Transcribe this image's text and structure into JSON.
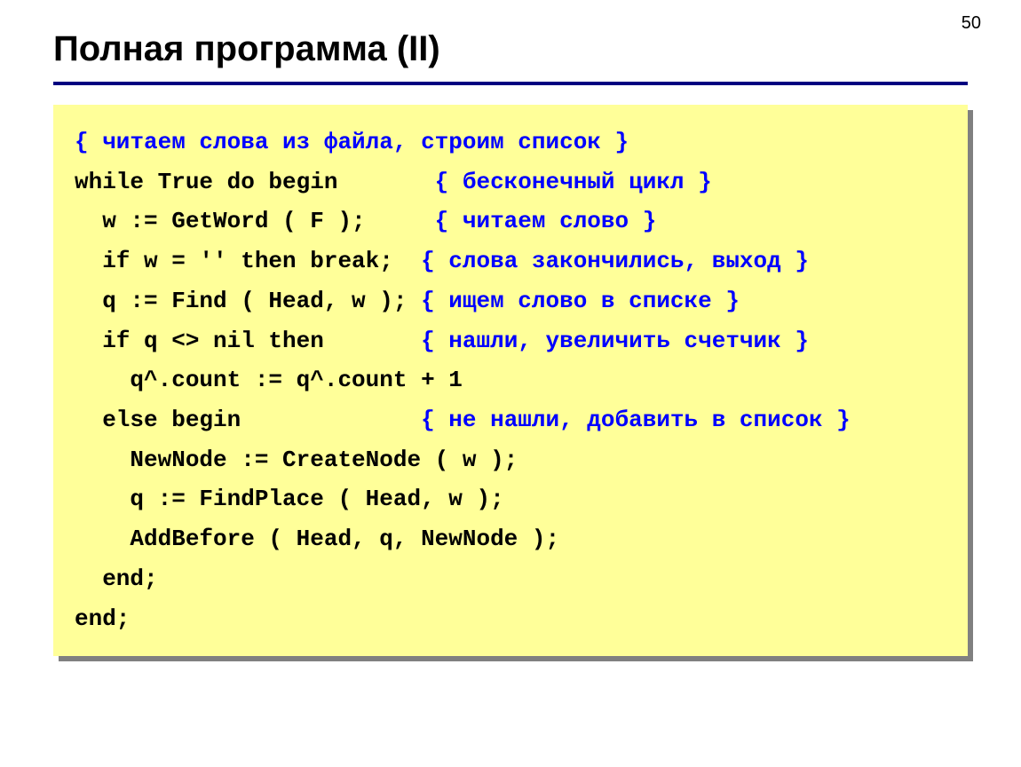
{
  "page_number": "50",
  "title": "Полная программа (II)",
  "code": {
    "line1_cmt": "{ читаем слова из файла, строим список }",
    "line2_kw": "while True do begin",
    "line2_cmt": "{ бесконечный цикл }",
    "line3_kw": "  w := GetWord ( F );",
    "line3_cmt": "{ читаем слово }",
    "line4_kw": "  if w = '' then break;",
    "line4_cmt": "{ слова закончились, выход }",
    "line5_kw": "  q := Find ( Head, w );",
    "line5_cmt": "{ ищем слово в списке }",
    "line6_kw": "  if q <> nil then",
    "line6_cmt": "{ нашли, увеличить счетчик }",
    "line7_kw": "    q^.count := q^.count + 1",
    "line8_kw": "  else begin",
    "line8_cmt": "{ не нашли, добавить в список }",
    "line9_kw": "    NewNode := CreateNode ( w );",
    "line10_kw": "    q := FindPlace ( Head, w );",
    "line11_kw": "    AddBefore ( Head, q, NewNode );",
    "line12_kw": "  end;",
    "line13_kw": "end;"
  }
}
